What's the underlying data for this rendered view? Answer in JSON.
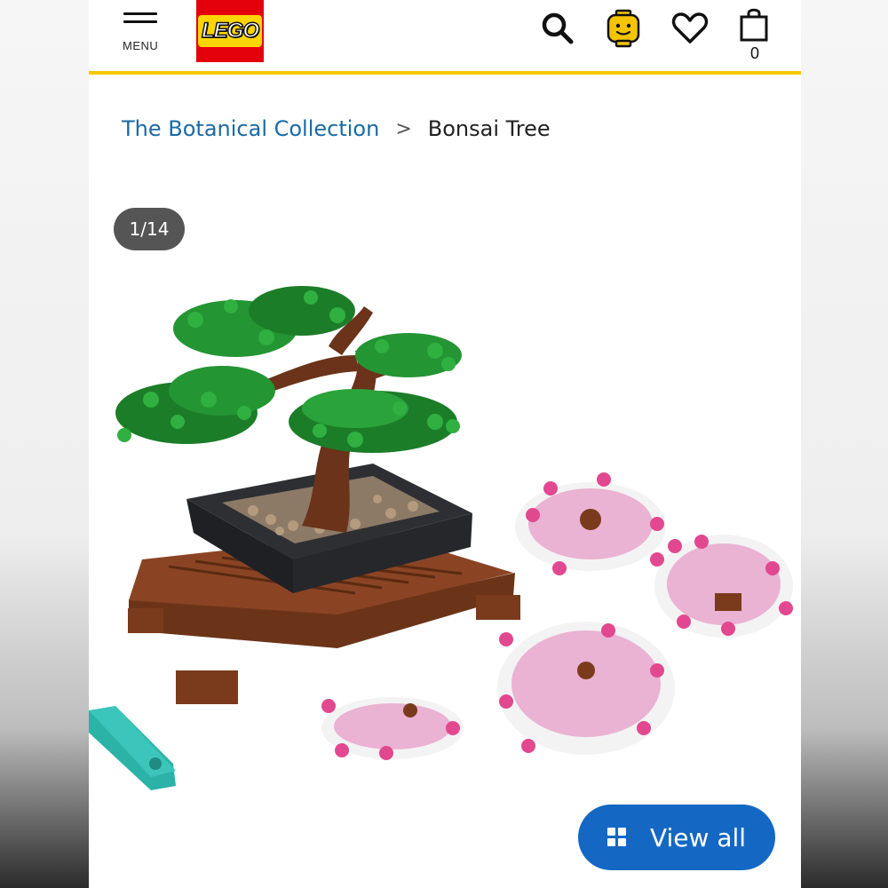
{
  "header": {
    "menu_label": "MENU",
    "logo_text": "LEGO",
    "bag_count": "0",
    "icons": [
      "menu-icon",
      "search-icon",
      "account-icon",
      "heart-icon",
      "shopping-bag-icon"
    ],
    "accent_color": "#f6c800"
  },
  "breadcrumb": {
    "parent": "The Botanical Collection",
    "separator": ">",
    "current": "Bonsai Tree"
  },
  "gallery": {
    "counter": "1/14",
    "view_all_label": "View all",
    "view_all_color": "#1468c4"
  }
}
